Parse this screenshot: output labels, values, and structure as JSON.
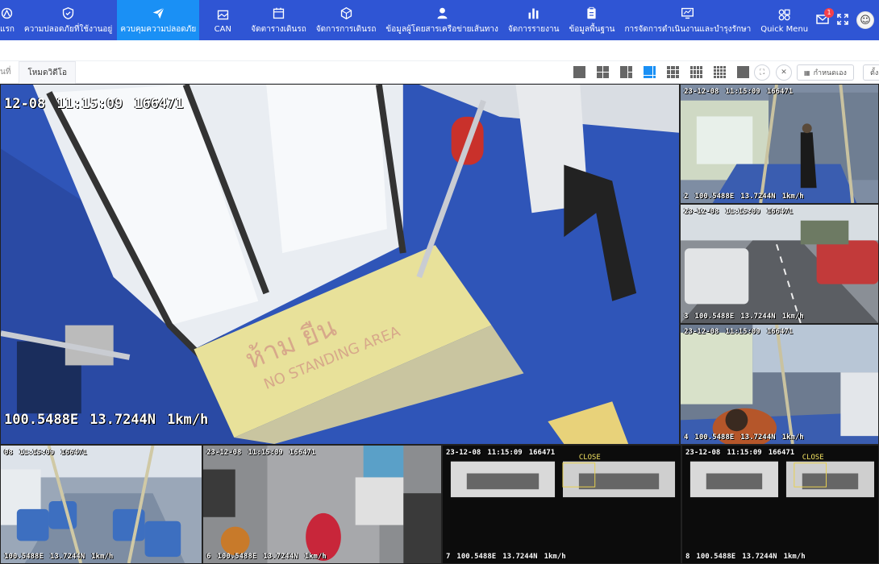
{
  "nav": {
    "items": [
      {
        "label": "แรก",
        "icon": "home-icon"
      },
      {
        "label": "ความปลอดภัยที่ใช้งานอยู่",
        "icon": "shield-icon"
      },
      {
        "label": "ควบคุมความปลอดภัย",
        "icon": "paper-plane-icon",
        "active": true
      },
      {
        "label": "CAN",
        "icon": "image-icon"
      },
      {
        "label": "จัดตารางเดินรถ",
        "icon": "calendar-icon"
      },
      {
        "label": "จัดการการเดินรถ",
        "icon": "cube-icon"
      },
      {
        "label": "ข้อมูลผู้โดยสารเครือข่ายเส้นทาง",
        "icon": "users-icon"
      },
      {
        "label": "จัดการรายงาน",
        "icon": "bar-chart-icon"
      },
      {
        "label": "ข้อมูลพื้นฐาน",
        "icon": "clipboard-icon"
      },
      {
        "label": "การจัดการดำเนินงานและบำรุงรักษา",
        "icon": "monitor-icon"
      },
      {
        "label": "Quick Menu",
        "icon": "grid-icon"
      }
    ],
    "notifications": "1",
    "avatar_glyph": "☺"
  },
  "toolbar": {
    "tab_dim": "นที่",
    "tab_active": "โหมดวิดีโอ",
    "custom_label": "กำหนดเอง",
    "extra_label": "ตั้ง"
  },
  "cams": {
    "c1": {
      "top": [
        "12-08",
        "11:15:09",
        "166471"
      ],
      "bottom": [
        "100.5488E",
        "13.7244N",
        "1km/h"
      ]
    },
    "c2": {
      "top": [
        "23-12-08",
        "11:15:09",
        "166471"
      ],
      "bottom": [
        "2",
        "100.5488E",
        "13.7244N",
        "1km/h"
      ]
    },
    "c3": {
      "top": [
        "23-12-08",
        "11:15:09",
        "166471"
      ],
      "bottom": [
        "3",
        "100.5488E",
        "13.7244N",
        "1km/h"
      ]
    },
    "c4": {
      "top": [
        "23-12-08",
        "11:15:09",
        "166471"
      ],
      "bottom": [
        "4",
        "100.5488E",
        "13.7244N",
        "1km/h"
      ]
    },
    "c5": {
      "top": [
        "08",
        "11:15:09",
        "166471"
      ],
      "bottom": [
        "100.5488E",
        "13.7244N",
        "1km/h"
      ]
    },
    "c6": {
      "top": [
        "23-12-08",
        "11:15:09",
        "166471"
      ],
      "bottom": [
        "6",
        "100.5488E",
        "13.7244N",
        "1km/h"
      ]
    },
    "c7": {
      "top": [
        "23-12-08",
        "11:15:09",
        "166471"
      ],
      "bottom": [
        "7",
        "100.5488E",
        "13.7244N",
        "1km/h"
      ]
    },
    "c8": {
      "top": [
        "23-12-08",
        "11:15:09",
        "166471"
      ],
      "bottom": [
        "8",
        "100.5488E",
        "13.7244N",
        "1km/h"
      ]
    }
  },
  "scene_text": {
    "sign_thai": "ห้าม ยืน",
    "sign_en": "NO STANDING AREA",
    "overlay_close": "CLOSE"
  },
  "colors": {
    "nav_bg": "#2f55d4",
    "nav_active": "#1a90f5",
    "floor_blue": "#2f55b8"
  }
}
